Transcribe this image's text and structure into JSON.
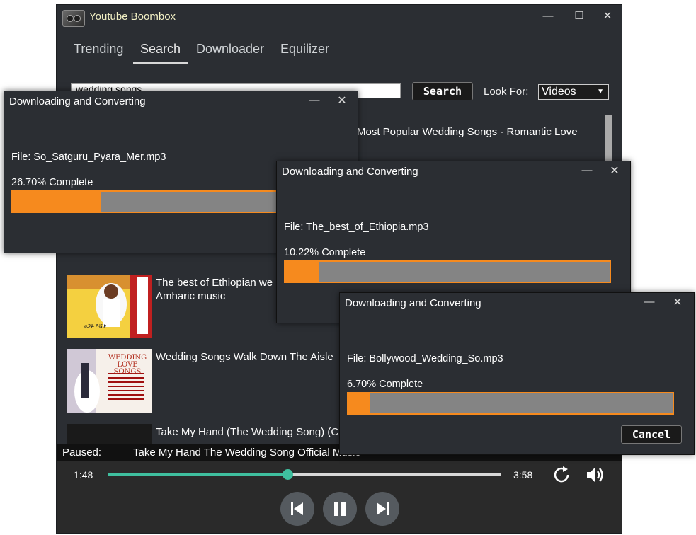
{
  "app": {
    "title": "Youtube Boombox"
  },
  "window_controls": {
    "minimize": "—",
    "maximize": "☐",
    "close": "✕"
  },
  "tabs": [
    {
      "label": "Trending",
      "active": false
    },
    {
      "label": "Search",
      "active": true
    },
    {
      "label": "Downloader",
      "active": false
    },
    {
      "label": "Equilizer",
      "active": false
    }
  ],
  "search": {
    "value": "wedding songs",
    "button_label": "Search",
    "look_for_label": "Look For:",
    "look_for_value": "Videos"
  },
  "results": [
    {
      "title": "Most Popular Wedding Songs - Romantic Love"
    },
    {
      "title": "The best of Ethiopian wedding songs Amharic music",
      "line1": "The best of Ethiopian we",
      "line2": "Amharic music"
    },
    {
      "title": "Wedding Songs Walk Down The Aisle"
    },
    {
      "title": "Take My Hand (The Wedding Song) (C"
    }
  ],
  "thumbnails": {
    "wedding_love_songs": "WEDDING LOVE SONGS",
    "ethiopia_caption": "ፀጋዬ እሸቱ"
  },
  "status_bar": {
    "label": "Paused:",
    "track": "Take My Hand The Wedding Song Official Music"
  },
  "player": {
    "current_time": "1:48",
    "total_time": "3:58",
    "progress": 0.457
  },
  "dialogs": [
    {
      "title": "Downloading and Converting",
      "file": "File: So_Satguru_Pyara_Mer.mp3",
      "percent_text": "26.70% Complete",
      "progress": 0.267
    },
    {
      "title": "Downloading and Converting",
      "file": "File: The_best_of_Ethiopia.mp3",
      "percent_text": "10.22% Complete",
      "progress": 0.1022
    },
    {
      "title": "Downloading and Converting",
      "file": "File: Bollywood_Wedding_So.mp3",
      "percent_text": "6.70% Complete",
      "progress": 0.067,
      "cancel_label": "Cancel"
    }
  ],
  "dialog_controls": {
    "minimize": "—",
    "close": "✕"
  },
  "colors": {
    "accent_orange": "#f68a1e",
    "seek_teal": "#3fbf9f",
    "background": "#2b2e33",
    "title_yellow": "#f2f0c4"
  }
}
